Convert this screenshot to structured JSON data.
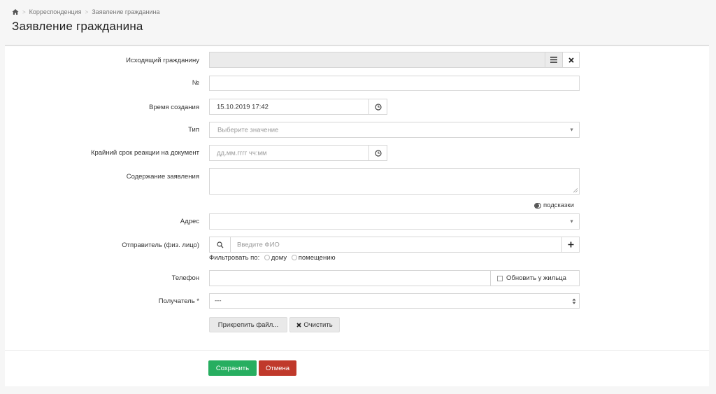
{
  "breadcrumb": {
    "items": [
      "Корреспонденция",
      "Заявление гражданина"
    ],
    "sep": ">"
  },
  "page_title": "Заявление гражданина",
  "form": {
    "outgoing": {
      "label": "Исходящий гражданину",
      "value": ""
    },
    "number": {
      "label": "№",
      "value": ""
    },
    "created": {
      "label": "Время создания",
      "value": "15.10.2019 17:42"
    },
    "type": {
      "label": "Тип",
      "placeholder": "Выберите значение"
    },
    "deadline": {
      "label": "Крайний срок реакции на документ",
      "placeholder": "дд.мм.гггг чч:мм"
    },
    "content": {
      "label": "Содержание заявления",
      "value": ""
    },
    "hints": {
      "label": "подсказки"
    },
    "address": {
      "label": "Адрес",
      "value": ""
    },
    "sender": {
      "label": "Отправитель (физ. лицо)",
      "placeholder": "Введите ФИО"
    },
    "filter": {
      "label": "Фильтровать по:",
      "options": [
        "дому",
        "помещению"
      ]
    },
    "phone": {
      "label": "Телефон",
      "value": "",
      "update_label": "Обновить у жильца"
    },
    "recipient": {
      "label": "Получатель *",
      "value": "---"
    }
  },
  "buttons": {
    "attach": "Прикрепить файл...",
    "clear": "Очистить",
    "save": "Сохранить",
    "cancel": "Отмена"
  },
  "colors": {
    "save": "#27ae60",
    "cancel": "#c0392b"
  },
  "icons": {
    "home": "home-icon",
    "list": "list-icon",
    "close": "close-icon",
    "clock": "clock-icon",
    "search": "search-icon",
    "plus": "plus-icon",
    "toggle": "toggle-icon",
    "caret": "caret-down-icon"
  }
}
